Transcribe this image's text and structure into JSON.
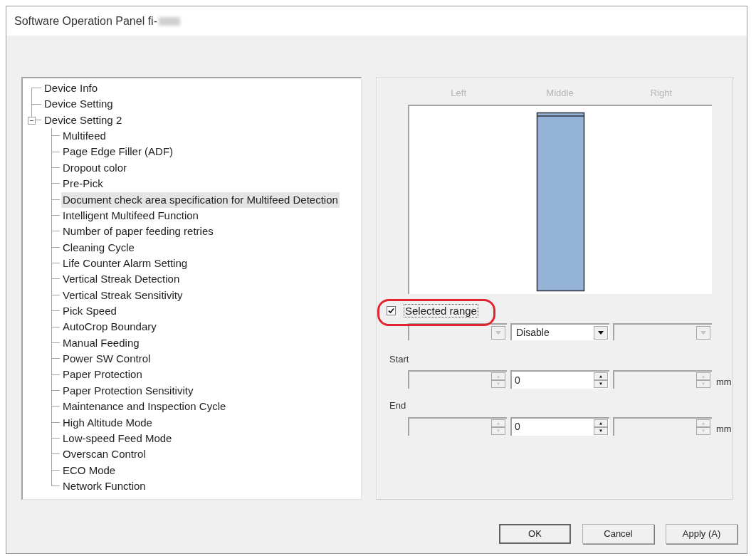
{
  "window": {
    "title": "Software Operation Panel fi-"
  },
  "tree": {
    "items": [
      {
        "label": "Device Info",
        "selected": false
      },
      {
        "label": "Device Setting",
        "selected": false
      },
      {
        "label": "Device Setting 2",
        "selected": false,
        "expanded": true,
        "children": [
          {
            "label": "Multifeed",
            "selected": false
          },
          {
            "label": "Page Edge Filler (ADF)",
            "selected": false
          },
          {
            "label": "Dropout color",
            "selected": false
          },
          {
            "label": "Pre-Pick",
            "selected": false
          },
          {
            "label": "Document check area specification for Multifeed Detection",
            "selected": true
          },
          {
            "label": "Intelligent Multifeed Function",
            "selected": false
          },
          {
            "label": "Number of paper feeding retries",
            "selected": false
          },
          {
            "label": "Cleaning Cycle",
            "selected": false
          },
          {
            "label": "Life Counter Alarm Setting",
            "selected": false
          },
          {
            "label": "Vertical Streak Detection",
            "selected": false
          },
          {
            "label": "Vertical Streak Sensitivity",
            "selected": false
          },
          {
            "label": "Pick Speed",
            "selected": false
          },
          {
            "label": "AutoCrop Boundary",
            "selected": false
          },
          {
            "label": "Manual Feeding",
            "selected": false
          },
          {
            "label": "Power SW Control",
            "selected": false
          },
          {
            "label": "Paper Protection",
            "selected": false
          },
          {
            "label": "Paper Protection Sensitivity",
            "selected": false
          },
          {
            "label": "Maintenance and Inspection Cycle",
            "selected": false
          },
          {
            "label": "High Altitude Mode",
            "selected": false
          },
          {
            "label": "Low-speed Feed Mode",
            "selected": false
          },
          {
            "label": "Overscan Control",
            "selected": false
          },
          {
            "label": "ECO Mode",
            "selected": false
          },
          {
            "label": "Network Function",
            "selected": false
          }
        ]
      }
    ]
  },
  "area_panel": {
    "column_headers": [
      "Left",
      "Middle",
      "Right"
    ],
    "selected_range": {
      "label": "Selected range",
      "checked": true
    },
    "mode_dropdowns": [
      {
        "disabled": true
      },
      {
        "value": "Disable",
        "disabled": false
      },
      {
        "disabled": true
      }
    ],
    "start": {
      "label": "Start",
      "fields": [
        {
          "disabled": true
        },
        {
          "value": "0",
          "disabled": false
        },
        {
          "disabled": true
        }
      ],
      "unit": "mm"
    },
    "end": {
      "label": "End",
      "fields": [
        {
          "disabled": true
        },
        {
          "value": "0",
          "disabled": false
        },
        {
          "disabled": true
        }
      ],
      "unit": "mm"
    }
  },
  "buttons": [
    {
      "label": "OK",
      "default": true
    },
    {
      "label": "Cancel",
      "default": false
    },
    {
      "label": "Apply (A)",
      "default": false
    }
  ]
}
